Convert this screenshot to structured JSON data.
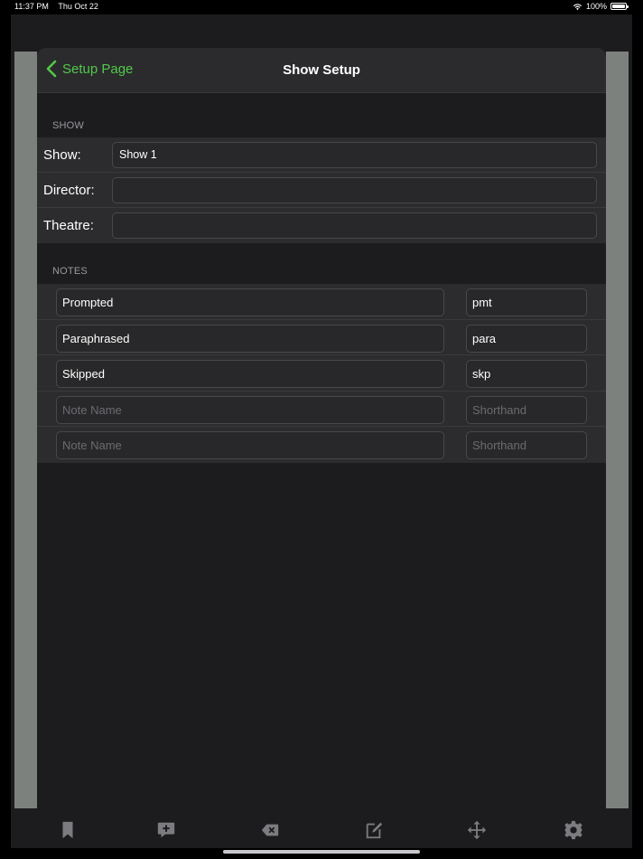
{
  "status": {
    "time": "11:37 PM",
    "date": "Thu Oct 22",
    "battery": "100%"
  },
  "nav": {
    "back_label": "Setup Page",
    "title": "Show Setup"
  },
  "show_section": {
    "header": "SHOW",
    "fields": [
      {
        "label": "Show:",
        "value": "Show 1"
      },
      {
        "label": "Director:",
        "value": ""
      },
      {
        "label": "Theatre:",
        "value": ""
      }
    ]
  },
  "notes_section": {
    "header": "NOTES",
    "placeholders": {
      "name": "Note Name",
      "shorthand": "Shorthand"
    },
    "rows": [
      {
        "name": "Prompted",
        "shorthand": "pmt"
      },
      {
        "name": "Paraphrased",
        "shorthand": "para"
      },
      {
        "name": "Skipped",
        "shorthand": "skp"
      },
      {
        "name": "",
        "shorthand": ""
      },
      {
        "name": "",
        "shorthand": ""
      }
    ]
  },
  "toolbar": {
    "items": [
      "bookmark-icon",
      "add-comment-icon",
      "delete-icon",
      "edit-icon",
      "move-icon",
      "gear-icon"
    ]
  },
  "colors": {
    "accent": "#52c84a",
    "background": "#1c1c1e",
    "row_background": "#2c2c2e",
    "side_panel": "#7d817d"
  }
}
